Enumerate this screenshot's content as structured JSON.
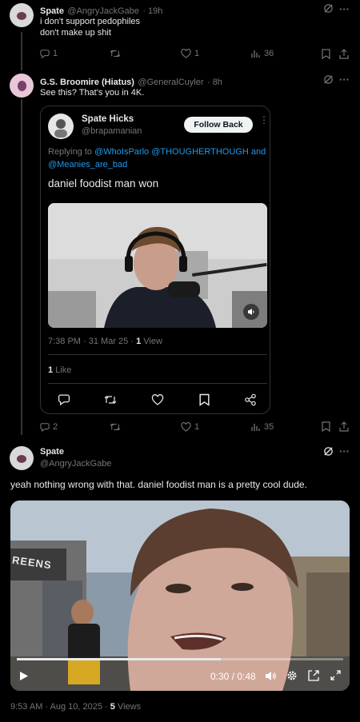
{
  "reply1": {
    "name": "Spate",
    "handle": "@AngryJackGabe",
    "time": "· 19h",
    "line1": "i don't support pedophiles",
    "line2": "don't make up shit",
    "stats": {
      "replies": "1",
      "likes": "1",
      "views": "36"
    }
  },
  "reply2": {
    "name": "G.S. Broomire (Hiatus)",
    "handle": "@GeneralCuyler",
    "time": "· 8h",
    "text": "See this? That's you in 4K.",
    "stats": {
      "replies": "2",
      "likes": "1",
      "views": "35"
    }
  },
  "quote": {
    "name": "Spate Hicks",
    "handle": "@brapamanian",
    "follow_label": "Follow Back",
    "replying_prefix": "Replying to",
    "mention1": "@WhoIsParlo",
    "mention2": "@THOUGHERTHOUGH",
    "and_text": "and",
    "mention3": "@Meanies_are_bad",
    "text": "daniel foodist man won",
    "time": "7:38 PM · 31 Mar 25 ·",
    "views_count": "1",
    "views_label": "View",
    "likes_count": "1",
    "likes_label": "Like"
  },
  "main": {
    "name": "Spate",
    "handle": "@AngryJackGabe",
    "text": "yeah nothing wrong with that. daniel foodist man is a pretty cool dude.",
    "video_time": "0:30 / 0:48",
    "video_progress": 0.625,
    "sign_text": "REENS",
    "timestamp": "9:53 AM · Aug 10, 2025 ·",
    "views_count": "5",
    "views_label": "Views"
  },
  "icons": [
    "grok-icon",
    "more-icon",
    "reply-icon",
    "retweet-icon",
    "like-icon",
    "views-icon",
    "bookmark-icon",
    "share-icon",
    "play-icon",
    "volume-icon",
    "settings-icon",
    "pip-icon",
    "fullscreen-icon"
  ],
  "colors": {
    "background": "#000000",
    "link": "#1d9bf0",
    "muted": "#71767b",
    "text": "#e7e9ea"
  }
}
